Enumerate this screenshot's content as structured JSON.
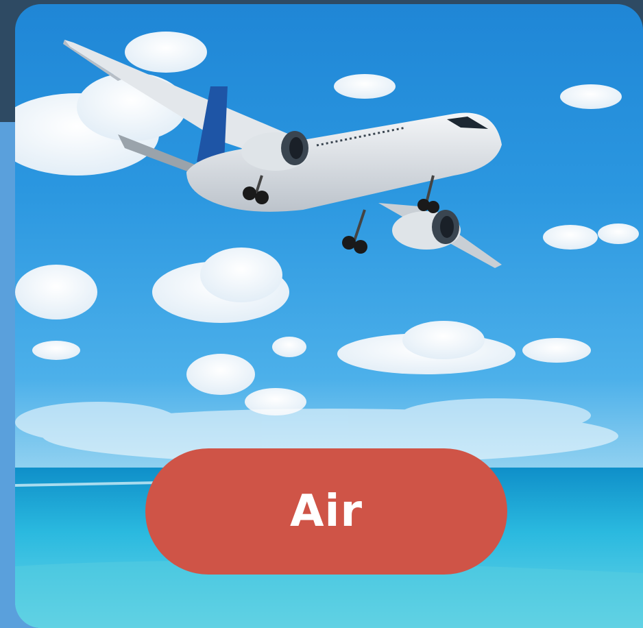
{
  "card": {
    "image_subject": "airplane-over-ocean",
    "button_label": "Air"
  },
  "colors": {
    "header": "#2e4a63",
    "page_background": "#5aa0dc",
    "button": "#cf5447",
    "button_text": "#ffffff"
  }
}
